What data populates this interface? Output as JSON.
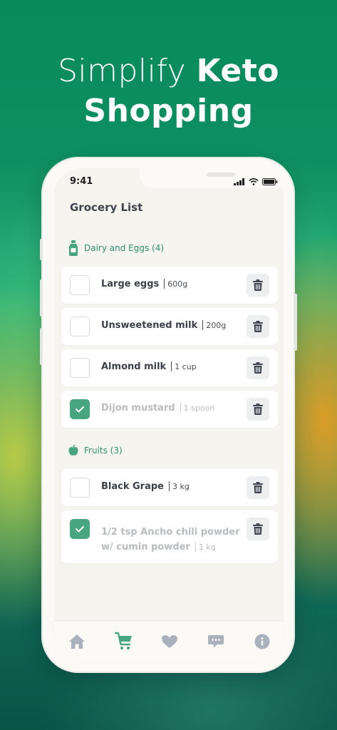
{
  "headline": {
    "light": "Simplify",
    "bold_1": "Keto",
    "bold_2": "Shopping"
  },
  "status_bar": {
    "time": "9:41"
  },
  "screen": {
    "title": "Grocery List"
  },
  "sections": [
    {
      "label": "Dairy and Eggs (4)",
      "icon": "milk-bottle-icon"
    },
    {
      "label": "Fruits (3)",
      "icon": "apple-icon"
    }
  ],
  "items": [
    {
      "name": "Large eggs",
      "qty": "600g",
      "checked": false
    },
    {
      "name": "Unsweetened milk",
      "qty": "200g",
      "checked": false
    },
    {
      "name": "Almond milk",
      "qty": "1 cup",
      "checked": false
    },
    {
      "name": "Dijon mustard",
      "qty": "1 spoon",
      "checked": true
    },
    {
      "name": "Black Grape",
      "qty": "3 kg",
      "checked": false
    },
    {
      "name_line1": "1/2 tsp Ancho chili powder",
      "name_line2": "w/ cumin powder",
      "qty": "1 kg",
      "checked": true
    }
  ],
  "tabs": [
    {
      "icon": "home-icon",
      "active": false
    },
    {
      "icon": "cart-icon",
      "active": true
    },
    {
      "icon": "heart-icon",
      "active": false
    },
    {
      "icon": "chat-icon",
      "active": false
    },
    {
      "icon": "info-icon",
      "active": false
    }
  ],
  "colors": {
    "accent": "#47a57f",
    "inactive_tab": "#a9b1bd",
    "text_dark": "#3c4049"
  }
}
